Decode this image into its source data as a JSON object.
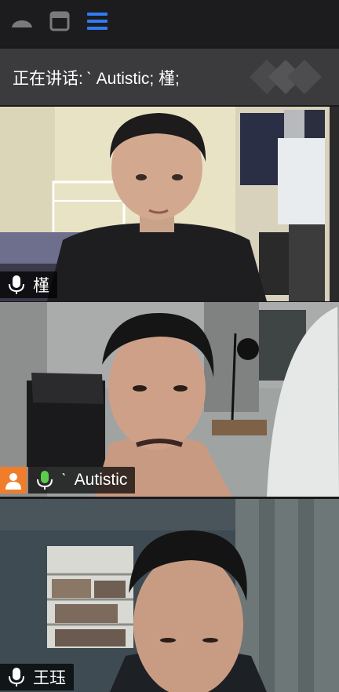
{
  "window": {
    "controls": [
      "minimize-icon",
      "window-icon",
      "menu-icon"
    ],
    "menu_icon_color": "#2f7cf6"
  },
  "speaker_bar": {
    "label": "正在讲话:",
    "speakers": "ˋ Autistic; 槿;"
  },
  "participants": [
    {
      "name": "槿",
      "mic_icon": "mic-icon",
      "mic_color": "#ffffff"
    },
    {
      "name": "ˋ Autistic",
      "tick": "ˋ",
      "display": "Autistic",
      "mic_icon": "mic-active-icon",
      "mic_color": "#5ccc4f",
      "avatar_color": "#ef7d2c",
      "active_speaker": true
    },
    {
      "name": "王珏",
      "mic_icon": "mic-icon",
      "mic_color": "#ffffff"
    }
  ],
  "colors": {
    "active_border": "#53c34d",
    "topbar_bg": "#1c1c1e",
    "speaker_bar_bg": "#3b3b3d"
  }
}
